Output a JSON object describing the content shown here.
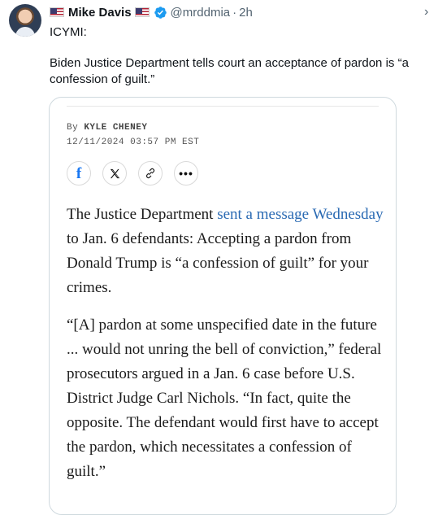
{
  "tweet": {
    "author_name": "Mike Davis",
    "handle": "@mrddmia",
    "separator": "·",
    "time": "2h",
    "intro": "ICYMI:",
    "text": "Biden Justice Department tells court an acceptance of pardon is “a confession of guilt.”"
  },
  "card": {
    "byline_prefix": "By ",
    "author": "KYLE CHENEY",
    "date": "12/11/2024 03:57 PM EST",
    "share_icons": [
      "facebook-icon",
      "x-icon",
      "link-icon",
      "more-icon"
    ],
    "p1_before": "The Justice Department ",
    "p1_link": "sent a message Wednesday",
    "p1_after": " to Jan. 6 defendants: Accepting a pardon from Donald Trump is “a confession of guilt” for your crimes.",
    "p2": "“[A] pardon at some unspecified date in the future ... would not unring the bell of conviction,” federal prosecutors argued in a Jan. 6 case before U.S. District Judge Carl Nichols. “In fact, quite the opposite. The defendant would first have to accept the pardon, which necessitates a confession of guilt.”"
  },
  "colors": {
    "link": "#2a6ab3",
    "verified": "#1d9bf0",
    "facebook": "#1877f2",
    "secondary_text": "#536471"
  }
}
